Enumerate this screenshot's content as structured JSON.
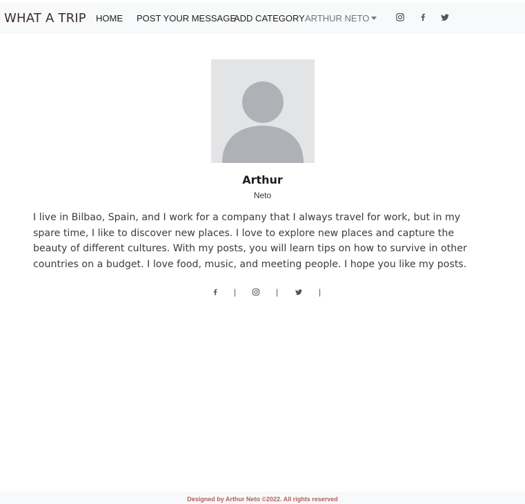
{
  "navbar": {
    "brand": "WHAT A TRIP",
    "links": {
      "home": "HOME",
      "post": "POST YOUR MESSAGE",
      "category": "ADD CATEGORY",
      "user": "ARTHUR NETO"
    },
    "social_icons": [
      "instagram-icon",
      "facebook-icon",
      "twitter-icon"
    ]
  },
  "profile": {
    "name": "Arthur",
    "surname": "Neto",
    "bio": "I live in Bilbao, Spain, and I work for a company that I always travel for work, but in my spare time, I like to discover new places. I love to explore new places and capture the beauty of different cultures. With my posts, you will learn tips on how to survive in other countries on a budget. I love food, music, and meeting people. I hope you like my posts.",
    "social_icons": [
      "facebook-icon",
      "instagram-icon",
      "twitter-icon"
    ],
    "separator": "|"
  },
  "footer": {
    "text": "Designed by Arthur Neto ©2022. All rights reserved"
  },
  "colors": {
    "navbar_bg": "#f8f9fa",
    "footer_text": "#b0605a",
    "avatar_bg": "#e3e4e6",
    "avatar_figure": "#aeb2b6"
  }
}
